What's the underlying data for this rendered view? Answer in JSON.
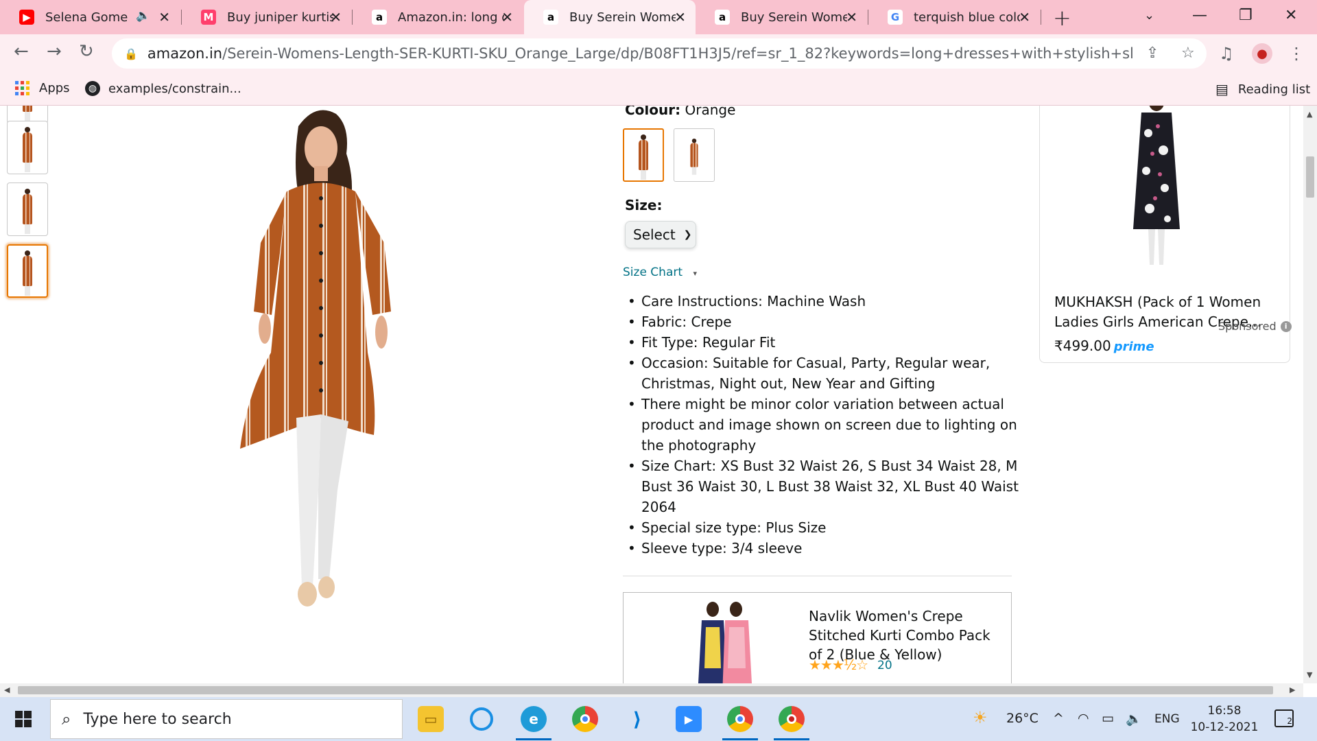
{
  "browser": {
    "tabs": [
      {
        "title": "Selena Gomez",
        "icon": "youtube-icon"
      },
      {
        "title": "Buy juniper kurtis O",
        "icon": "myntra-icon"
      },
      {
        "title": "Amazon.in: long dr",
        "icon": "amazon-icon"
      },
      {
        "title": "Buy Serein Women",
        "icon": "amazon-icon"
      },
      {
        "title": "Buy Serein Women",
        "icon": "amazon-icon"
      },
      {
        "title": "terquish blue colou",
        "icon": "google-icon"
      }
    ],
    "url_host": "amazon.in",
    "url_path": "/Serein-Womens-Length-SER-KURTI-SKU_Orange_Large/dp/B08FT1H3J5/ref=sr_1_82?keywords=long+dresses+with+stylish+sleeves+for+wom...",
    "bookmarks": [
      {
        "label": "Apps"
      },
      {
        "label": "examples/constrain..."
      }
    ],
    "reading_list": "Reading list"
  },
  "product": {
    "colour_label": "Colour:",
    "colour_value": "Orange",
    "size_label": "Size:",
    "size_select": "Select",
    "size_chart": "Size Chart",
    "bullets": [
      "Care Instructions: Machine Wash",
      "Fabric: Crepe",
      "Fit Type: Regular Fit",
      "Occasion: Suitable for Casual, Party, Regular wear, Christmas, Night out, New Year and Gifting",
      "There might be minor color variation between actual product and image shown on screen due to lighting on the photography",
      "Size Chart: XS Bust 32 Waist 26, S Bust 34 Waist 28, M Bust 36 Waist 30, L Bust 38 Waist 32, XL Bust 40 Waist 2064",
      "Special size type: Plus Size",
      "Sleeve type: 3/4 sleeve"
    ]
  },
  "ad": {
    "title": "Navlik Women's Crepe Stitched Kurti Combo Pack of 2 (Blue & Yellow)",
    "stars": "★★★½☆",
    "reviews": "20"
  },
  "sponsored_card": {
    "title": "MUKHAKSH (Pack of 1 Women Ladies Girls American Crepe...",
    "price": "₹499.00",
    "prime": "prime",
    "sponsored_label": "Sponsored"
  },
  "taskbar": {
    "search_placeholder": "Type here to search",
    "weather": "26°C",
    "language": "ENG",
    "time": "16:58",
    "date": "10-12-2021",
    "notifications": "2"
  },
  "colors": {
    "accent_orange": "#e77600",
    "link_teal": "#007185",
    "tab_pink": "#f9c2cf"
  }
}
